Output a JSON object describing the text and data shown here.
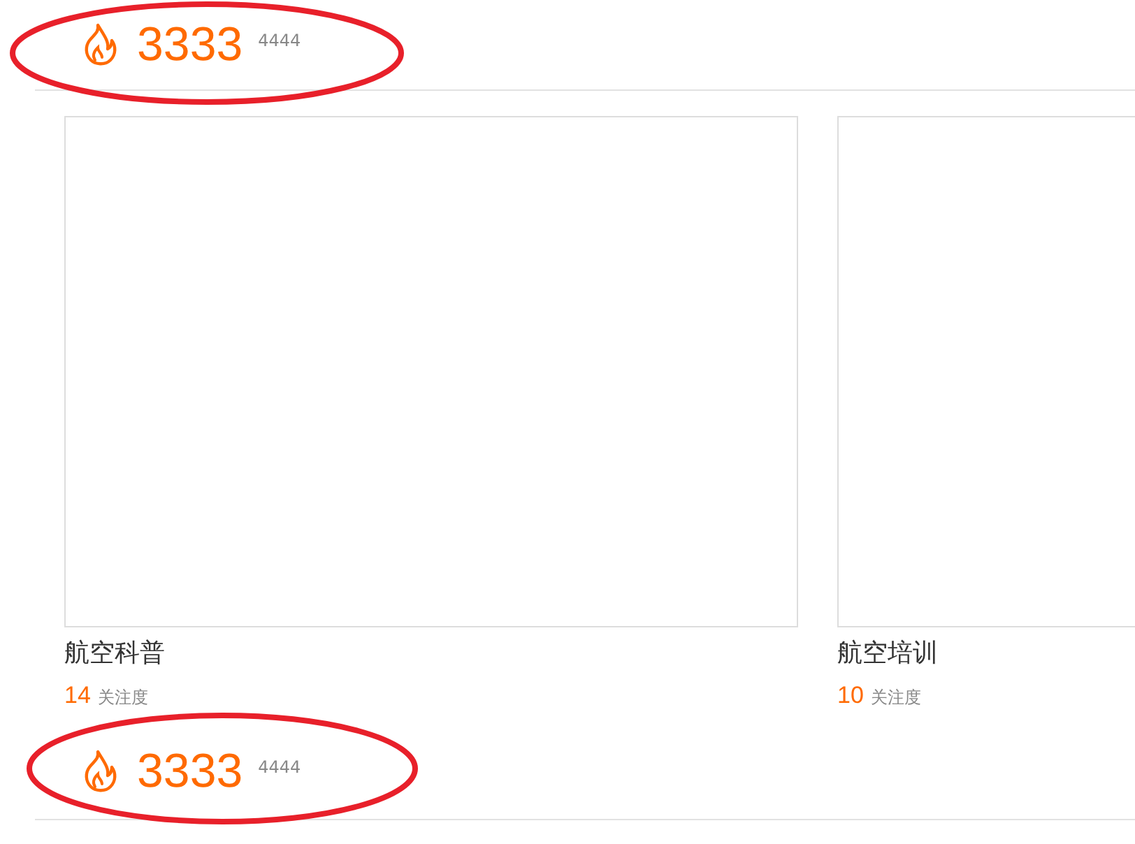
{
  "header": {
    "count": "3333",
    "sub_count": "4444",
    "annotated": true
  },
  "cards": [
    {
      "title": "航空科普",
      "count": "14",
      "count_label": "关注度"
    },
    {
      "title": "航空培训",
      "count": "10",
      "count_label": "关注度"
    }
  ],
  "footer": {
    "count": "3333",
    "sub_count": "4444",
    "annotated": true
  }
}
